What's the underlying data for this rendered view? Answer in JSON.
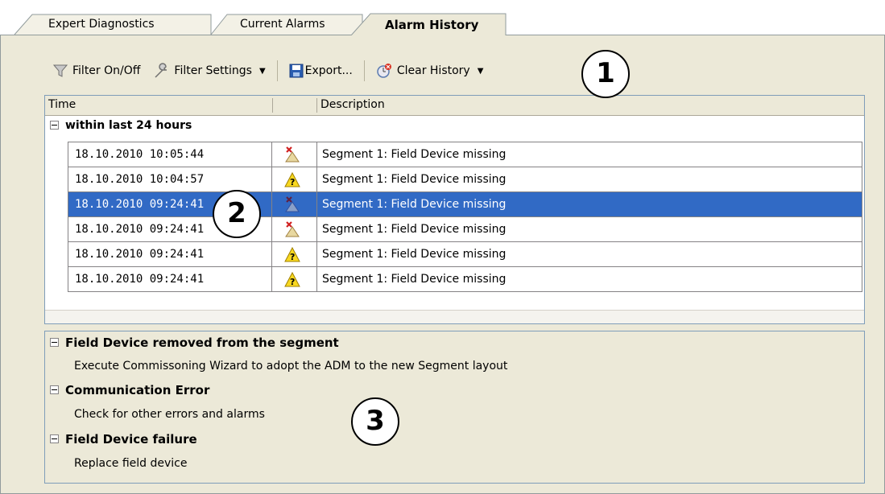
{
  "tabs": [
    {
      "label": "Expert Diagnostics"
    },
    {
      "label": "Current Alarms"
    },
    {
      "label": "Alarm History"
    }
  ],
  "toolbar": {
    "filter_onoff": "Filter On/Off",
    "filter_settings": "Filter Settings",
    "export": "Export...",
    "clear_history": "Clear History"
  },
  "callouts": {
    "c1": "1",
    "c2": "2",
    "c3": "3"
  },
  "grid": {
    "headers": {
      "time": "Time",
      "icon": "",
      "description": "Description"
    },
    "group": "within last 24 hours",
    "rows": [
      {
        "time": "18.10.2010 10:05:44",
        "icon": "device-removed-icon",
        "description": "Segment 1: Field Device missing"
      },
      {
        "time": "18.10.2010 10:04:57",
        "icon": "warning-icon",
        "description": "Segment 1: Field Device missing"
      },
      {
        "time": "18.10.2010 09:24:41",
        "icon": "device-removed-icon",
        "description": "Segment 1: Field Device missing"
      },
      {
        "time": "18.10.2010 09:24:41",
        "icon": "device-removed-icon",
        "description": "Segment 1: Field Device missing"
      },
      {
        "time": "18.10.2010 09:24:41",
        "icon": "warning-icon",
        "description": "Segment 1: Field Device missing"
      },
      {
        "time": "18.10.2010 09:24:41",
        "icon": "warning-icon",
        "description": "Segment 1: Field Device missing"
      }
    ],
    "selected_row": 2
  },
  "details": [
    {
      "title": "Field Device removed from the segment",
      "text": "Execute Commissoning Wizard to adopt the ADM to the new Segment layout"
    },
    {
      "title": "Communication Error",
      "text": "Check for other errors and alarms"
    },
    {
      "title": "Field Device failure",
      "text": "Replace field device"
    }
  ],
  "colors": {
    "selection": "#316ac5",
    "panel": "#ece9d8",
    "border": "#7f9db9"
  }
}
